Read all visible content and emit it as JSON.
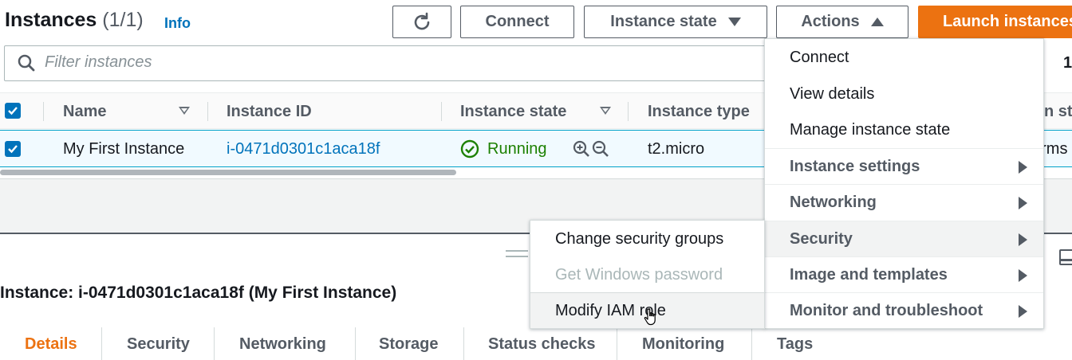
{
  "header": {
    "title": "Instances",
    "count": "(1/1)",
    "info": "Info"
  },
  "toolbar": {
    "refresh_icon": "refresh-icon",
    "connect": "Connect",
    "instance_state": "Instance state",
    "actions": "Actions",
    "launch": "Launch instances"
  },
  "filter": {
    "placeholder": "Filter instances",
    "page": "1"
  },
  "table": {
    "columns": [
      "Name",
      "Instance ID",
      "Instance state",
      "Instance type",
      "n sta"
    ],
    "rows": [
      {
        "name": "My First Instance",
        "instance_id": "i-0471d0301c1aca18f",
        "state": "Running",
        "type": "t2.micro",
        "extra": "arms"
      }
    ]
  },
  "details": {
    "title": "Instance: i-0471d0301c1aca18f (My First Instance)",
    "tabs": [
      "Details",
      "Security",
      "Networking",
      "Storage",
      "Status checks",
      "Monitoring",
      "Tags"
    ]
  },
  "actions_menu": {
    "items": [
      "Connect",
      "View details",
      "Manage instance state",
      "Instance settings",
      "Networking",
      "Security",
      "Image and templates",
      "Monitor and troubleshoot"
    ]
  },
  "security_submenu": {
    "items": [
      "Change security groups",
      "Get Windows password",
      "Modify IAM role"
    ]
  },
  "colors": {
    "accent": "#ec7211",
    "link": "#0073bb",
    "running": "#1d8102"
  }
}
